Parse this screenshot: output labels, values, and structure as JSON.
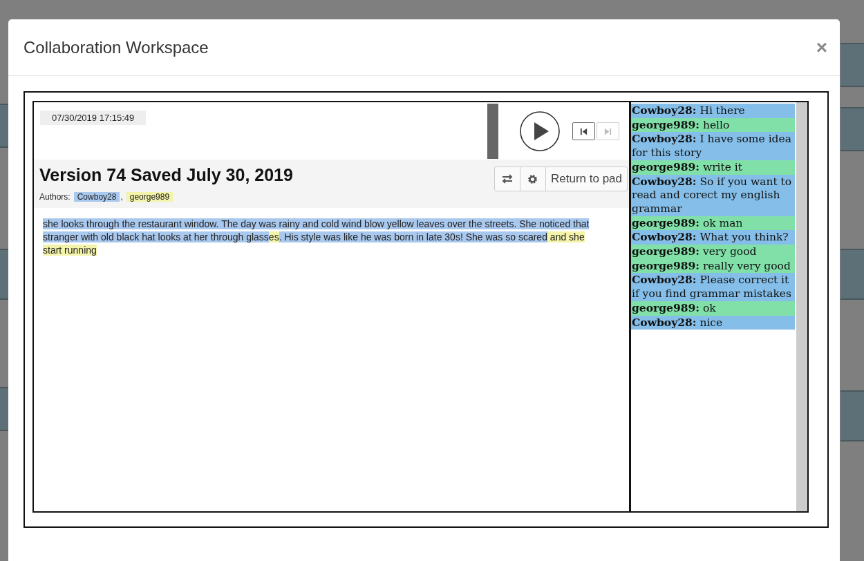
{
  "modal": {
    "title": "Collaboration Workspace",
    "close": "×"
  },
  "player": {
    "timestamp": "07/30/2019 17:15:49",
    "prev_disabled": false,
    "next_disabled": true
  },
  "version": {
    "title": "Version 74 Saved July 30, 2019",
    "authors_label": "Authors:",
    "separator": ",",
    "authors": [
      {
        "name": "Cowboy28",
        "color": "#a9c8ee"
      },
      {
        "name": "george989",
        "color": "#f3f3a9"
      }
    ],
    "toolbar": {
      "return_label": "Return to pad"
    }
  },
  "story": [
    {
      "color": "#a9c8ee",
      "text": "she looks through the restaurant window. The day was rainy and cold wind blow yellow leaves over the streets. She noticed that  stranger with old black hat looks at her through glass"
    },
    {
      "color": "#f3f3a9",
      "text": "es"
    },
    {
      "color": "#a9c8ee",
      "text": ". His style was like he was born in late 30s! She was so scared"
    },
    {
      "color": "#f3f3a9",
      "text": " and she start running"
    }
  ],
  "chat": {
    "messages": [
      {
        "color": "#85bfe9",
        "name": "Cowboy28:",
        "text": "Hi there"
      },
      {
        "color": "#80e0a8",
        "name": "george989:",
        "text": "hello"
      },
      {
        "color": "#85bfe9",
        "name": "Cowboy28:",
        "text": "I have some idea for this story"
      },
      {
        "color": "#80e0a8",
        "name": "george989:",
        "text": "write it"
      },
      {
        "color": "#85bfe9",
        "name": "Cowboy28:",
        "text": "So if you want to read and corect my english grammar"
      },
      {
        "color": "#80e0a8",
        "name": "george989:",
        "text": "ok man"
      },
      {
        "color": "#85bfe9",
        "name": "Cowboy28:",
        "text": "What you think?"
      },
      {
        "color": "#80e0a8",
        "name": "george989:",
        "text": "very good"
      },
      {
        "color": "#80e0a8",
        "name": "george989:",
        "text": "really very good"
      },
      {
        "color": "#85bfe9",
        "name": "Cowboy28:",
        "text": "Please correct it if you find grammar mistakes"
      },
      {
        "color": "#80e0a8",
        "name": "george989:",
        "text": "ok"
      },
      {
        "color": "#85bfe9",
        "name": "Cowboy28:",
        "text": "nice"
      }
    ]
  }
}
